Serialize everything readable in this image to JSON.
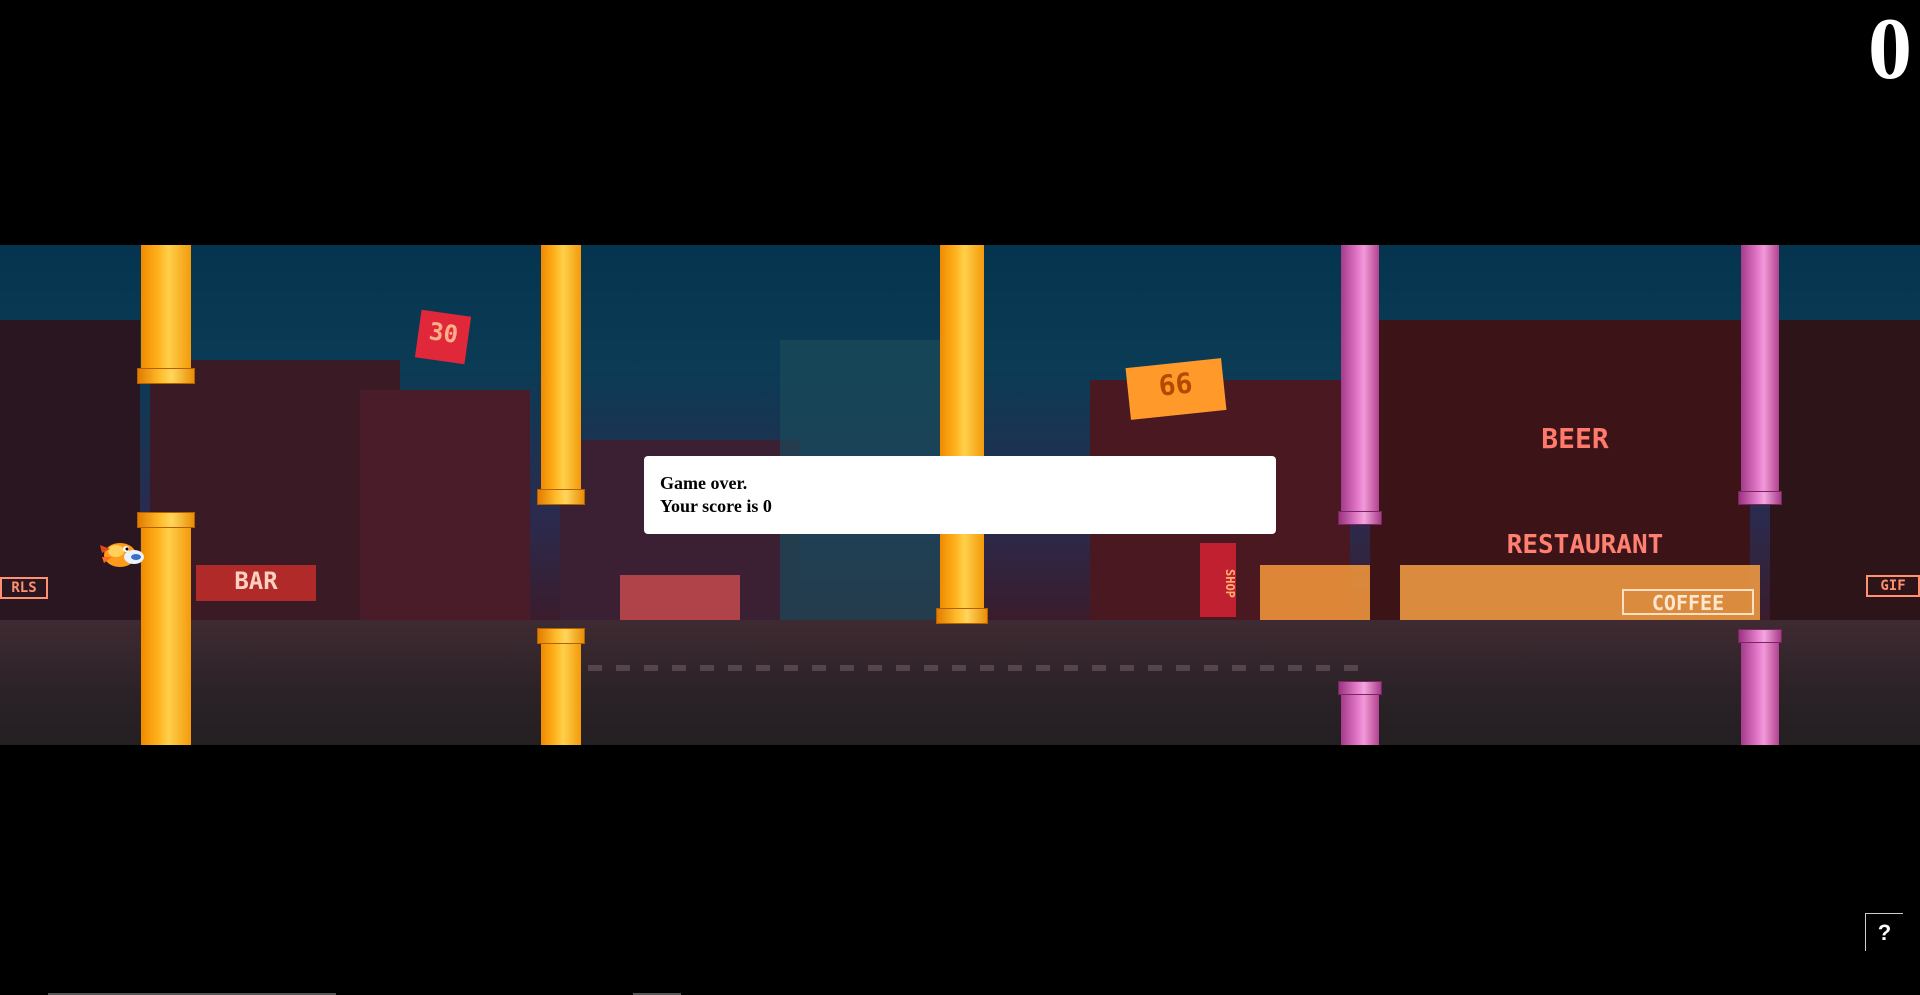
{
  "hud": {
    "score": "0"
  },
  "dialog": {
    "line1": "Game over.",
    "line2": "Your score is 0"
  },
  "help": {
    "label": "?"
  },
  "scene": {
    "signs": {
      "bar": "BAR",
      "beer": "BEER",
      "restaurant": "RESTAURANT",
      "coffee": "COFFEE",
      "shop": "SHOP",
      "num30": "30",
      "num66": "66",
      "girls_left": "RLS",
      "girls_right": "GIF"
    }
  },
  "colors": {
    "pipe_orange": "#ffb21e",
    "pipe_pink": "#e57acb",
    "dialog_bg": "#ffffff"
  },
  "icons": {
    "bird": "bird-sprite",
    "help": "question-mark"
  }
}
